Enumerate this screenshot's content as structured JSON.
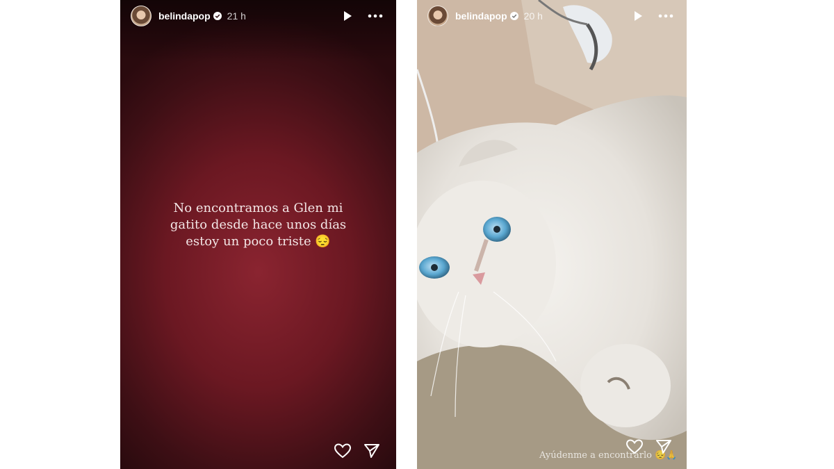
{
  "stories": [
    {
      "username": "belindapop",
      "time": "21 h",
      "text": "No encontramos a Glen mi gatito desde hace unos días estoy un poco triste 😔"
    },
    {
      "username": "belindapop",
      "time": "20 h",
      "caption": "Ayúdenme a encontrarlo 😔🙏"
    }
  ],
  "icons": {
    "play": "play-icon",
    "more": "more-options-icon",
    "like": "heart-icon",
    "share": "send-icon",
    "verified": "verified-badge-icon"
  },
  "colors": {
    "story_bg": "#6b1822",
    "verified_blue": "#3897f0"
  }
}
